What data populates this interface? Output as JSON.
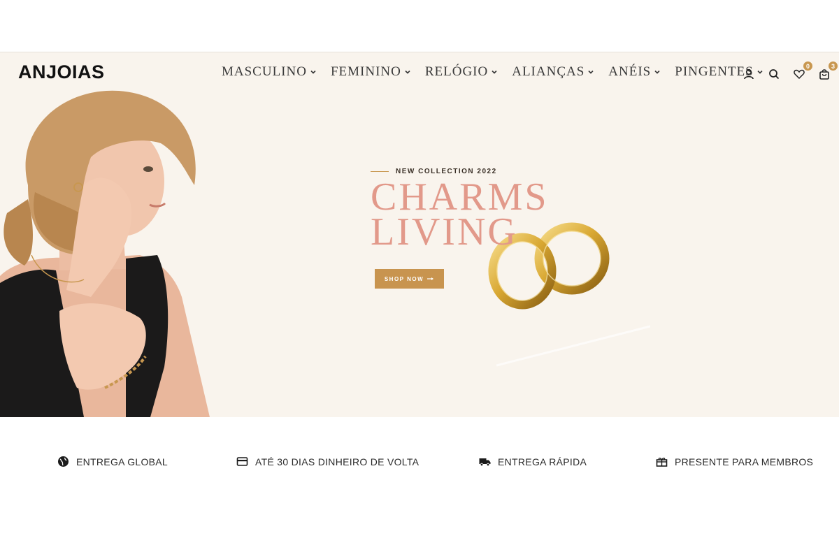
{
  "brand": {
    "logo": "ANJOIAS"
  },
  "nav": {
    "items": [
      {
        "label": "MASCULINO"
      },
      {
        "label": "FEMININO"
      },
      {
        "label": "RELÓGIO"
      },
      {
        "label": "ALIANÇAS"
      },
      {
        "label": "ANÉIS"
      },
      {
        "label": "PINGENTES"
      }
    ]
  },
  "header_icons": {
    "account": "user-icon",
    "search": "search-icon",
    "wishlist": {
      "icon": "heart-icon",
      "count": "0"
    },
    "cart": {
      "icon": "bag-icon",
      "count": "3"
    }
  },
  "hero": {
    "eyebrow": "NEW COLLECTION 2022",
    "headline_line1": "CHARMS",
    "headline_line2": "LIVING",
    "cta_label": "SHOP NOW",
    "cta_icon": "arrow-right-icon"
  },
  "features": [
    {
      "icon": "globe-icon",
      "label": "ENTREGA GLOBAL"
    },
    {
      "icon": "card-icon",
      "label": "ATÉ 30 DIAS DINHEIRO DE VOLTA"
    },
    {
      "icon": "truck-icon",
      "label": "ENTREGA RÁPIDA"
    },
    {
      "icon": "gift-icon",
      "label": "PRESENTE PARA MEMBROS"
    }
  ],
  "colors": {
    "hero_bg": "#f9f4ed",
    "accent_gold": "#c8944f",
    "headline_pink": "#e2998a"
  }
}
